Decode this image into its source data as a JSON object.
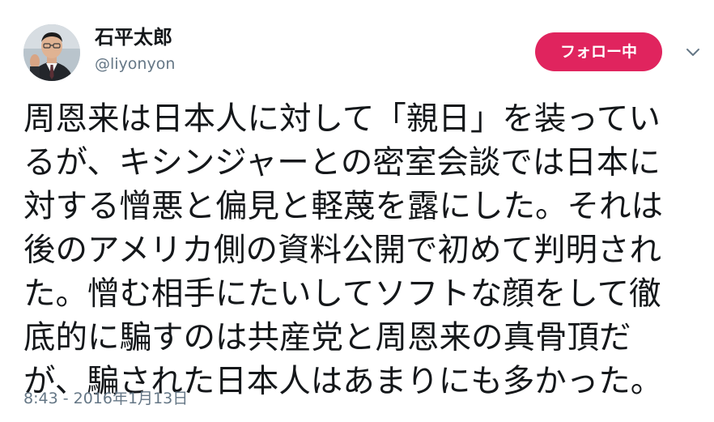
{
  "user": {
    "display_name": "石平太郎",
    "username": "@liyonyon"
  },
  "follow_button": {
    "label": "フォロー中",
    "color": "#e0245e"
  },
  "more_icon": "chevron-down-icon",
  "tweet": {
    "lines": [
      "周恩来は日本人に対して「親日」を装ってい",
      "るが、キシンジャーとの密室会談では日本に",
      "対する憎悪と偏見と軽蔑を露にした。それは",
      "後のアメリカ側の資料公開で初めて判明され",
      "た。憎む相手にたいしてソフトな顔をして徹",
      "底的に騙すのは共産党と周恩来の真骨頂だ",
      "が、騙された日本人はあまりにも多かった。"
    ],
    "timestamp": "8:43 - 2016年1月13日"
  },
  "colors": {
    "text": "#14171a",
    "secondary": "#657786",
    "accent": "#e0245e"
  }
}
